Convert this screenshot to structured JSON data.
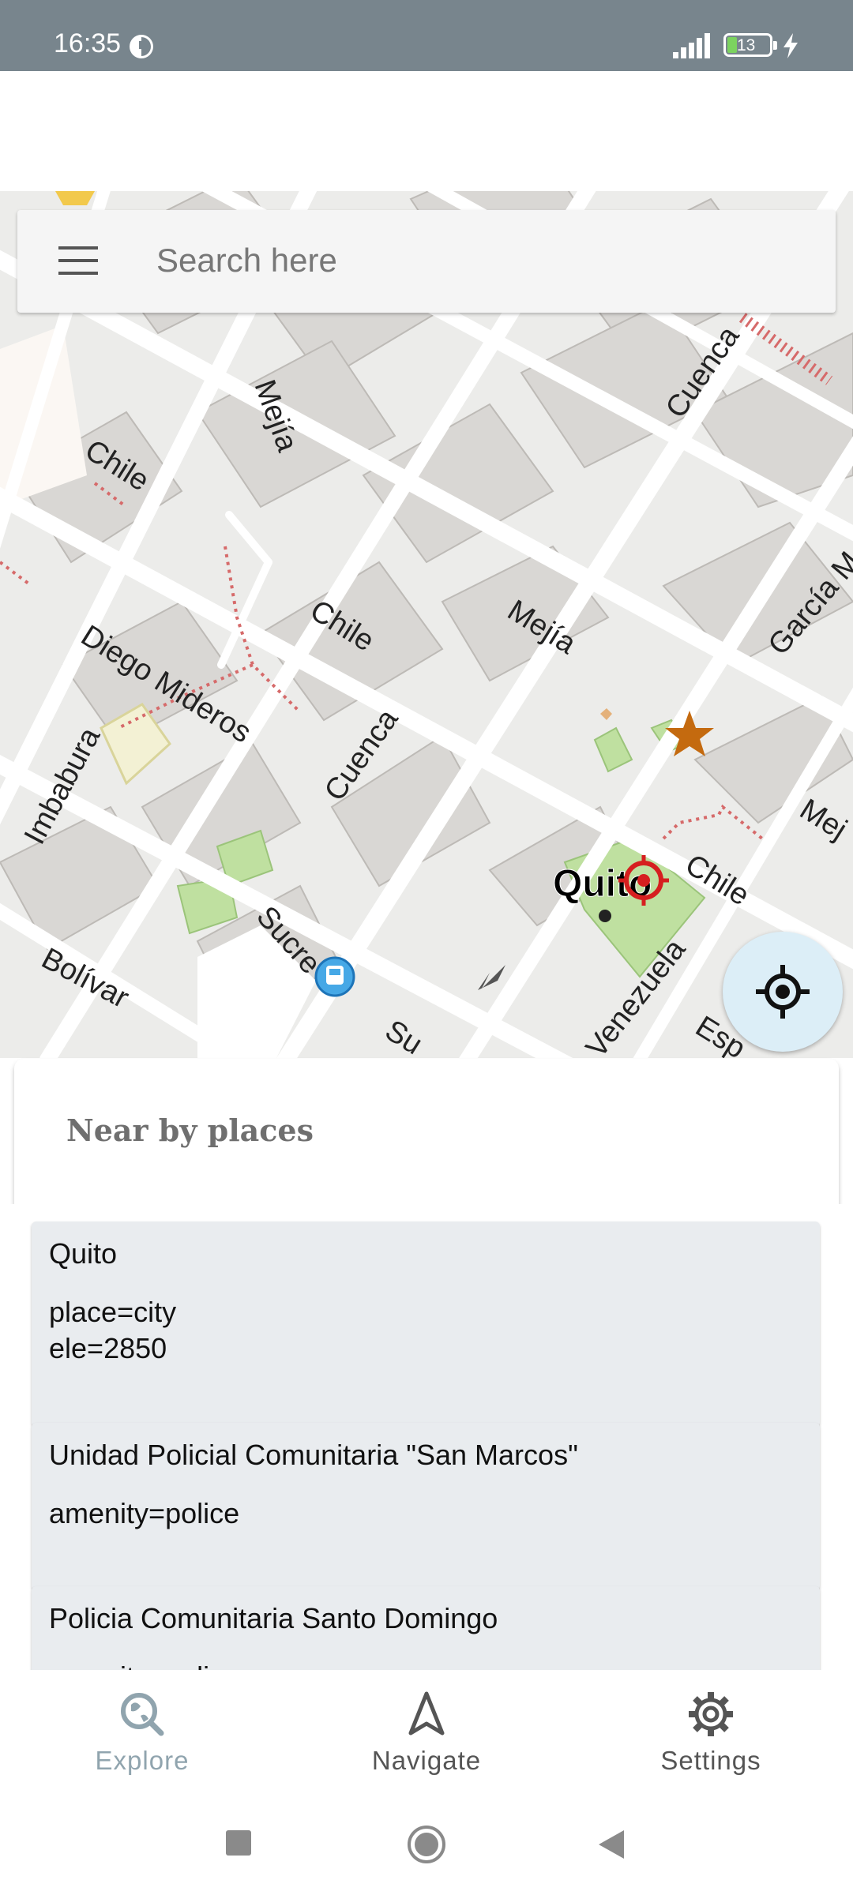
{
  "status_bar": {
    "time": "16:35",
    "battery": "13",
    "icons": [
      "data-saver-icon",
      "signal-icon",
      "battery-icon",
      "charging-icon"
    ]
  },
  "search": {
    "placeholder": "Search here",
    "menu_icon": "hamburger-menu-icon"
  },
  "map": {
    "city_label": "Quito",
    "streets": [
      "Chile",
      "Mejía",
      "Cuenca",
      "Chile",
      "Mejía",
      "Cuenca",
      "García M",
      "Diego Mideros",
      "Imbabura",
      "Cuenca",
      "Chile",
      "Sucre",
      "Bolívar",
      "Venezuela",
      "Esp",
      "Mej",
      "Su"
    ],
    "colors": {
      "road": "#ffffff",
      "building": "#d9d7d4",
      "park": "#a8d88a",
      "poi_star": "#c46a0f",
      "marker": "#d61f1f"
    }
  },
  "nearby": {
    "title": "Near by places",
    "places": [
      {
        "name": "Quito",
        "tags": [
          "place=city",
          "ele=2850"
        ]
      },
      {
        "name": "Unidad Policial Comunitaria \"San Marcos\"",
        "tags": [
          "amenity=police"
        ]
      },
      {
        "name": "Policia Comunitaria Santo Domingo",
        "tags": [
          "amenity=police"
        ]
      }
    ]
  },
  "bottom_nav": {
    "items": [
      {
        "label": "Explore",
        "icon": "explore-icon",
        "active": true
      },
      {
        "label": "Navigate",
        "icon": "navigate-icon",
        "active": false
      },
      {
        "label": "Settings",
        "icon": "settings-icon",
        "active": false
      }
    ]
  },
  "system_nav": {
    "icons": [
      "recents-icon",
      "home-icon",
      "back-icon"
    ]
  }
}
